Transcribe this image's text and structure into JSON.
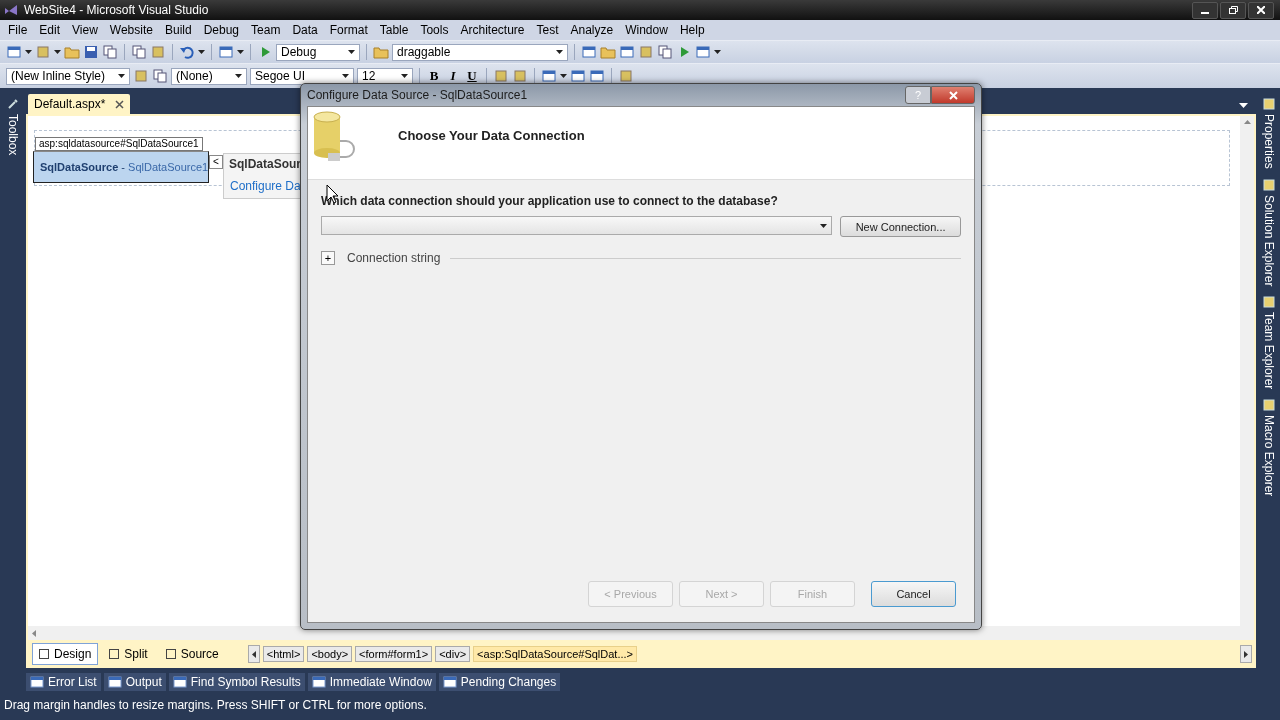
{
  "window": {
    "title": "WebSite4 - Microsoft Visual Studio"
  },
  "menu": [
    "File",
    "Edit",
    "View",
    "Website",
    "Build",
    "Debug",
    "Team",
    "Data",
    "Format",
    "Table",
    "Tools",
    "Architecture",
    "Test",
    "Analyze",
    "Window",
    "Help"
  ],
  "standard_toolbar": {
    "configuration": "Debug",
    "find": "draggable"
  },
  "format_toolbar": {
    "style": "(New Inline Style)",
    "block": "(None)",
    "font": "Segoe UI",
    "size": "12",
    "buttons": [
      "B",
      "I",
      "U"
    ]
  },
  "left_panels": [
    "Toolbox"
  ],
  "right_panels": [
    "Properties",
    "Solution Explorer",
    "Team Explorer",
    "Macro Explorer"
  ],
  "document_tabs": [
    {
      "label": "Default.aspx*",
      "selected": true
    }
  ],
  "designer": {
    "tag_label": "asp:sqldatasource#SqlDataSource1",
    "control_type": "SqlDataSource",
    "separator": "-",
    "control_id": "SqlDataSource1",
    "smart_tag": {
      "button": "<",
      "title": "SqlDataSour",
      "action": "Configure Da"
    }
  },
  "view_tabs": [
    {
      "label": "Design",
      "selected": true
    },
    {
      "label": "Split",
      "selected": false
    },
    {
      "label": "Source",
      "selected": false
    }
  ],
  "breadcrumbs": [
    {
      "label": "<html>",
      "selected": false
    },
    {
      "label": "<body>",
      "selected": false
    },
    {
      "label": "<form#form1>",
      "selected": false
    },
    {
      "label": "<div>",
      "selected": false
    },
    {
      "label": "<asp:SqlDataSource#SqlDat...>",
      "selected": true
    }
  ],
  "tool_windows": [
    "Error List",
    "Output",
    "Find Symbol Results",
    "Immediate Window",
    "Pending Changes"
  ],
  "status_bar": "Drag margin handles to resize margins. Press SHIFT or CTRL for more options.",
  "dialog": {
    "title": "Configure Data Source - SqlDataSource1",
    "help": "?",
    "heading": "Choose Your Data Connection",
    "question": "Which data connection should your application use to connect to the database?",
    "new_connection": "New Connection...",
    "expander": "+",
    "section": "Connection string",
    "buttons": [
      {
        "label": "< Previous",
        "disabled": true
      },
      {
        "label": "Next >",
        "disabled": true
      },
      {
        "label": "Finish",
        "disabled": true
      },
      {
        "label": "Cancel",
        "disabled": false
      }
    ]
  }
}
